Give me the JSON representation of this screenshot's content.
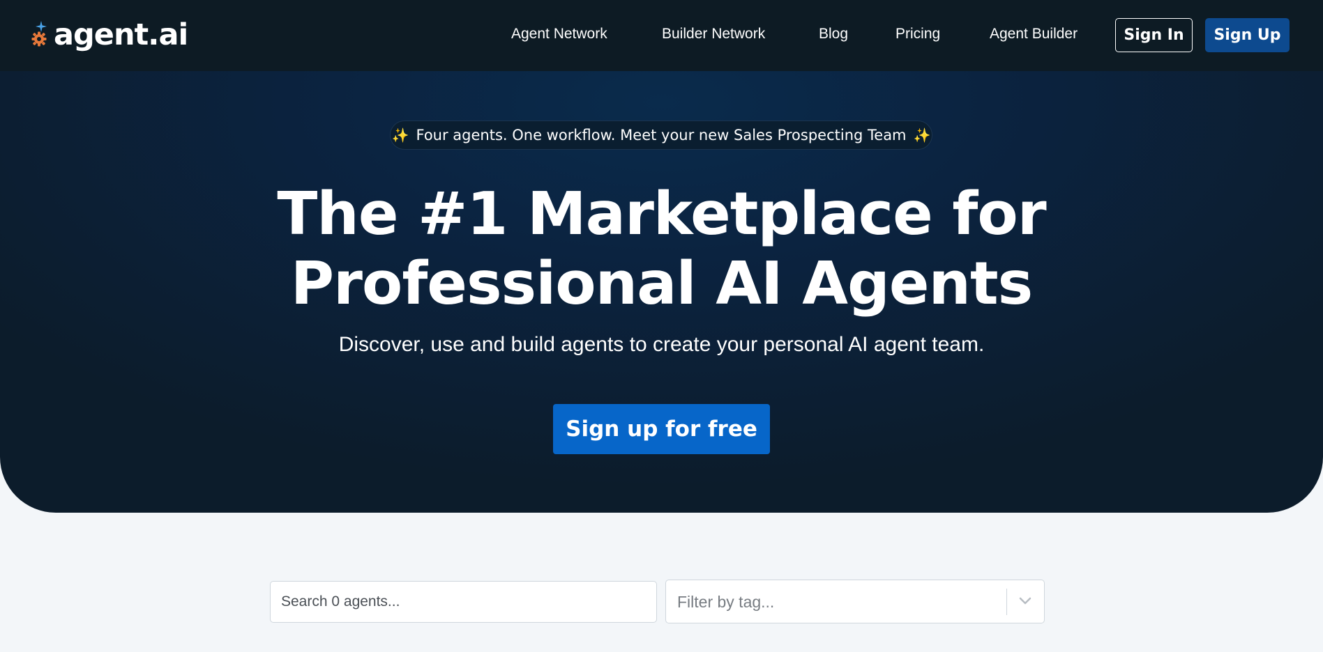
{
  "brand": {
    "name": "agent.ai",
    "logo_icon": "gear-sparkle-icon"
  },
  "nav": {
    "links": [
      "Agent Network",
      "Builder Network",
      "Blog",
      "Pricing",
      "Agent Builder"
    ],
    "sign_in": "Sign In",
    "sign_up": "Sign Up"
  },
  "hero": {
    "announcement": "Four agents. One workflow. Meet your new Sales Prospecting Team",
    "announcement_icon": "✨",
    "headline_line1": "The #1 Marketplace for",
    "headline_line2": "Professional AI Agents",
    "subheadline": "Discover, use and build agents to create your personal AI agent team.",
    "cta": "Sign up for free"
  },
  "search": {
    "placeholder": "Search 0 agents..."
  },
  "tag_filter": {
    "placeholder": "Filter by tag..."
  },
  "colors": {
    "nav_bg": "#0d1b24",
    "hero_bg": "#0b2340",
    "primary": "#0766c9",
    "sign_up_bg": "#0d4a8f",
    "page_bg": "#f3f6f9",
    "logo_orange": "#e8793a",
    "logo_blue": "#4aa3e8"
  }
}
